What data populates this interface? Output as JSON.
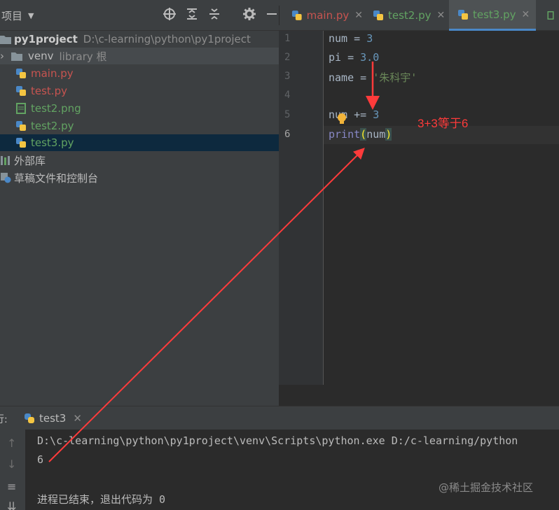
{
  "toolbar": {
    "project_label": "项目"
  },
  "tabs": [
    {
      "label": "main.py"
    },
    {
      "label": "test2.py"
    },
    {
      "label": "test3.py"
    }
  ],
  "tree": {
    "root_name": "py1project",
    "root_path": "D:\\c-learning\\python\\py1project",
    "venv_name": "venv",
    "venv_note": "library 根",
    "files": [
      "main.py",
      "test.py",
      "test2.png",
      "test2.py",
      "test3.py"
    ],
    "external_libs": "外部库",
    "scratches": "草稿文件和控制台"
  },
  "editor": {
    "line_numbers": [
      "1",
      "2",
      "3",
      "4",
      "5",
      "6"
    ],
    "line1": {
      "var": "num",
      "op": " = ",
      "val": "3"
    },
    "line2": {
      "var": "pi",
      "op": " = ",
      "val": "3.0"
    },
    "line3": {
      "var": "name",
      "op": " = ",
      "val": "'朱科宇'"
    },
    "line5": {
      "var": "num",
      "op": " += ",
      "val": "3"
    },
    "line6": {
      "fn": "print",
      "open": "(",
      "arg": "num",
      "close": ")"
    },
    "annotation": "3+3等于6"
  },
  "run": {
    "label": "运行:",
    "tab_label": "test3",
    "command": "D:\\c-learning\\python\\py1project\\venv\\Scripts\\python.exe D:/c-learning/python",
    "output": "6",
    "exit_message": "进程已结束，退出代码为 0",
    "watermark": "@稀土掘金技术社区"
  }
}
